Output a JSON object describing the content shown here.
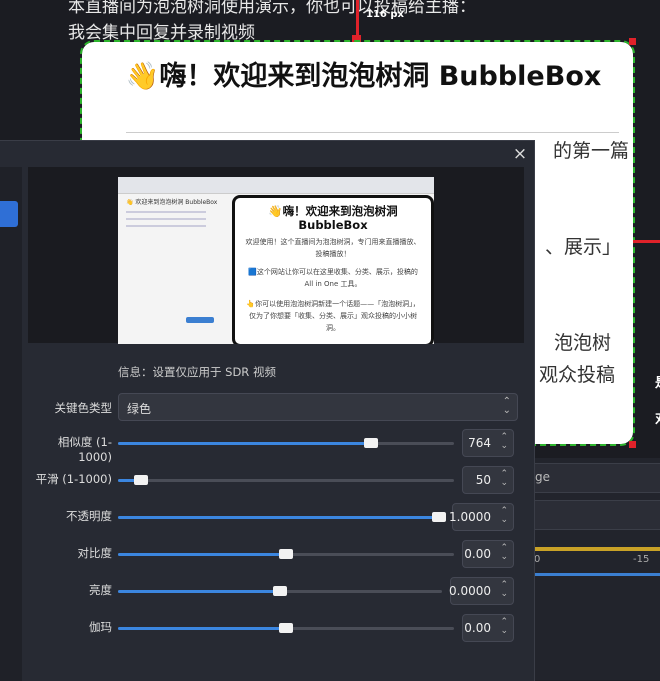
{
  "background": {
    "line1": "本直播间为泡泡树洞使用演示，你也可以投稿给主播：",
    "line2": "我会集中回复并录制视频",
    "handle_label": "116 px",
    "card_title": "👋嗨！欢迎来到泡泡树洞 BubbleBox",
    "card_fragments": [
      "的第一篇",
      "、展示」",
      "泡泡树",
      "观众投稿"
    ],
    "right_marks": [
      "是",
      "对"
    ],
    "input_partial": "ge",
    "meter_ticks": [
      "0",
      "-15"
    ]
  },
  "preview": {
    "thumb_page_title": "👋 欢迎来到泡泡树洞 BubbleBox",
    "thumb_card_title": "👋嗨！欢迎来到泡泡树洞 BubbleBox",
    "thumb_paragraphs": [
      "欢迎使用！这个直播间为泡泡树洞，专门用来直播播放、投稿播放！",
      "🟦这个网站让你可以在这里收集、分类、展示，投稿的 All in One 工具。",
      "👆你可以使用泡泡树洞新建一个话题——「泡泡树洞」，仅为了你想要「收集、分类、展示」观众投稿的小小树洞。"
    ]
  },
  "dialog": {
    "close_label": "×",
    "info": "信息：设置仅应用于 SDR 视频",
    "key_color_type": {
      "label": "关键色类型",
      "value": "绿色"
    },
    "sliders": [
      {
        "id": "similarity",
        "label": "相似度 (1-1000)",
        "value": "764",
        "fraction": 0.764
      },
      {
        "id": "smoothness",
        "label": "平滑 (1-1000)",
        "value": "50",
        "fraction": 0.05
      },
      {
        "id": "opacity",
        "label": "不透明度",
        "value": "1.0000",
        "fraction": 1.0
      },
      {
        "id": "contrast",
        "label": "对比度",
        "value": "0.00",
        "fraction": 0.5
      },
      {
        "id": "brightness",
        "label": "亮度",
        "value": "0.0000",
        "fraction": 0.5
      },
      {
        "id": "gamma",
        "label": "伽玛",
        "value": "0.00",
        "fraction": 0.5
      }
    ]
  },
  "colors": {
    "accent": "#3b86e0",
    "guide_red": "#e0222a",
    "guide_green": "#2db52d"
  }
}
